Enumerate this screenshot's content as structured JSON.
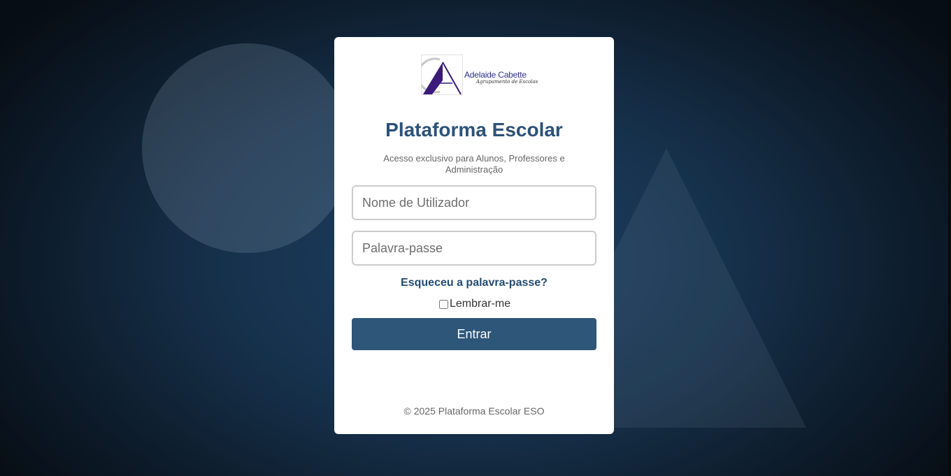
{
  "brand": {
    "logo_name": "Adelaide Cabette",
    "logo_tagline": "Agrupamento de Escolas",
    "logo_letters": "CA",
    "colors": {
      "logo_purple": "#3a1a7a",
      "logo_gray": "#c8c8c8"
    }
  },
  "login": {
    "title": "Plataforma Escolar",
    "subtitle": "Acesso exclusivo para Alunos, Professores e Administração",
    "username": {
      "value": "",
      "placeholder": "Nome de Utilizador"
    },
    "password": {
      "value": "",
      "placeholder": "Palavra-passe"
    },
    "forgot_label": "Esqueceu a palavra-passe?",
    "remember_label": "Lembrar-me",
    "remember_checked": false,
    "submit_label": "Entrar"
  },
  "footer": {
    "text": "© 2025 Plataforma Escolar ESO"
  },
  "theme": {
    "accent": "#2d5679",
    "title_color": "#2c5278",
    "background": "#16304a"
  }
}
